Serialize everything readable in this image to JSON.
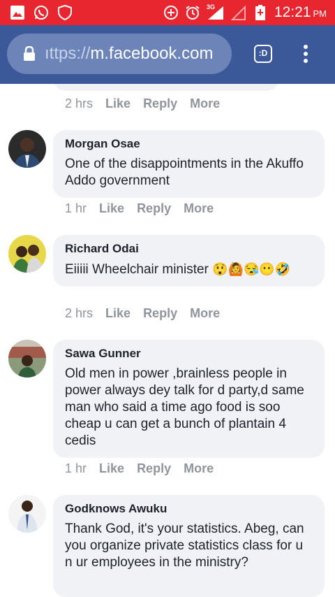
{
  "status_bar": {
    "network_label": "3G",
    "time": "12:21",
    "ampm": "PM"
  },
  "browser": {
    "url_prefix": "ıttps://",
    "url_domain": "m.facebook.com",
    "tabs_label": ":D"
  },
  "previous_actions": {
    "time": "2 hrs",
    "like": "Like",
    "reply": "Reply",
    "more": "More"
  },
  "comments": [
    {
      "author": "Morgan Osae",
      "text": "One of the disappointments in the Akuffo Addo government",
      "time": "1 hr",
      "like": "Like",
      "reply": "Reply",
      "more": "More"
    },
    {
      "author": "Richard Odai",
      "text": "Eiiiii Wheelchair minister",
      "emojis": "😲🙆😪😶🤣",
      "time": "2 hrs",
      "like": "Like",
      "reply": "Reply",
      "more": "More"
    },
    {
      "author": "Sawa Gunner",
      "text": "Old men in power ,brainless people in power always dey talk for d party,d same man who said a time ago food is soo cheap u can get a bunch of plantain 4 cedis",
      "time": "1 hr",
      "like": "Like",
      "reply": "Reply",
      "more": "More"
    },
    {
      "author": "Godknows Awuku",
      "text": "Thank God, it's your statistics. Abeg, can you organize private statistics class for u n ur employees in the ministry?"
    }
  ],
  "colors": {
    "status_bar": "#e8262f",
    "browser_bar": "#3b5998",
    "bubble": "#f0f2f5",
    "meta_text": "#90949c"
  }
}
